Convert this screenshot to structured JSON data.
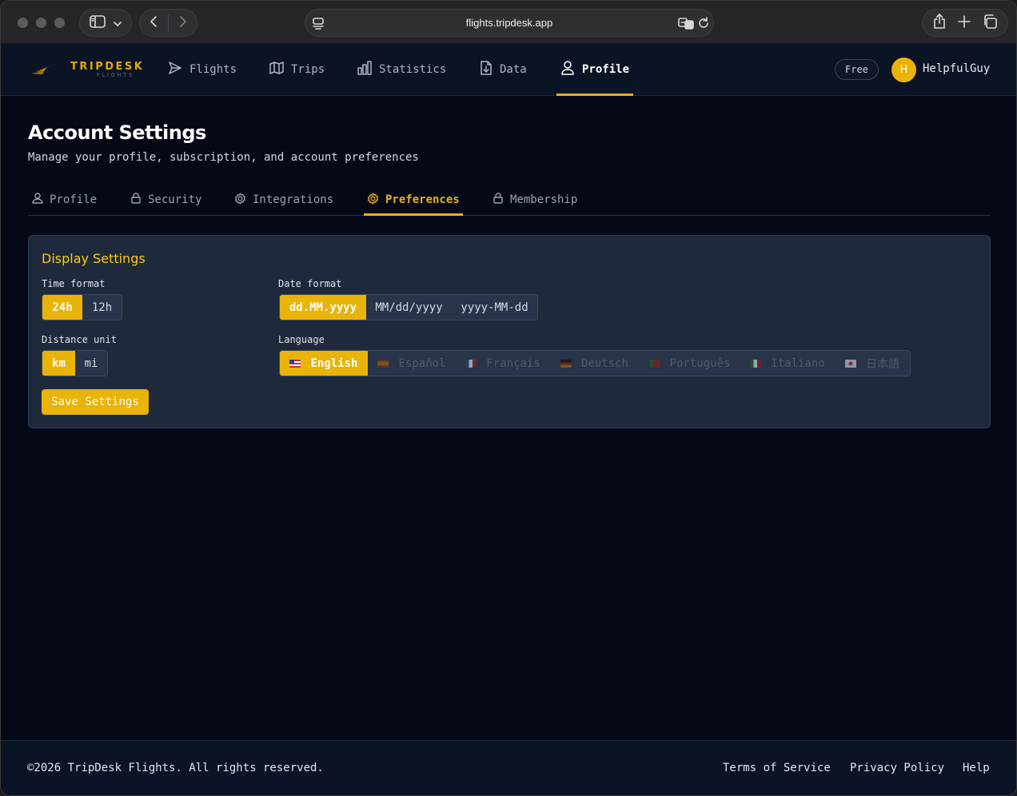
{
  "browser": {
    "url": "flights.tripdesk.app",
    "icons": [
      "sidebar-toggle-icon",
      "chevron-down-icon",
      "back-arrow-icon",
      "forward-arrow-icon",
      "page-menu-icon",
      "translate-icon",
      "reload-icon",
      "share-icon",
      "new-tab-icon",
      "tab-overview-icon"
    ]
  },
  "brand": {
    "name": "TRIPDESK",
    "sub": "FLIGHTS"
  },
  "nav": {
    "items": [
      {
        "label": "Flights",
        "icon": "send-icon"
      },
      {
        "label": "Trips",
        "icon": "map-icon"
      },
      {
        "label": "Statistics",
        "icon": "bar-chart-icon"
      },
      {
        "label": "Data",
        "icon": "file-download-icon"
      },
      {
        "label": "Profile",
        "icon": "user-icon",
        "active": true
      }
    ],
    "plan_badge": "Free",
    "avatar_initial": "H",
    "username": "HelpfulGuy"
  },
  "page": {
    "title": "Account Settings",
    "subtitle": "Manage your profile, subscription, and account preferences"
  },
  "tabs": [
    {
      "label": "Profile",
      "icon": "user-icon"
    },
    {
      "label": "Security",
      "icon": "lock-icon"
    },
    {
      "label": "Integrations",
      "icon": "gear-icon"
    },
    {
      "label": "Preferences",
      "icon": "gear-icon",
      "active": true
    },
    {
      "label": "Membership",
      "icon": "lock-icon"
    }
  ],
  "display_settings": {
    "title": "Display Settings",
    "time_format": {
      "label": "Time format",
      "options": [
        "24h",
        "12h"
      ],
      "selected": "24h"
    },
    "date_format": {
      "label": "Date format",
      "options": [
        "dd.MM.yyyy",
        "MM/dd/yyyy",
        "yyyy-MM-dd"
      ],
      "selected": "dd.MM.yyyy"
    },
    "distance_unit": {
      "label": "Distance unit",
      "options": [
        "km",
        "mi"
      ],
      "selected": "km"
    },
    "language": {
      "label": "Language",
      "options": [
        "English",
        "Español",
        "Français",
        "Deutsch",
        "Português",
        "Italiano",
        "日本語"
      ],
      "selected": "English"
    },
    "save_label": "Save Settings"
  },
  "colors": {
    "accent": "#eab308",
    "background": "#040817",
    "card": "#1e293b",
    "navbar": "#0b1424"
  },
  "footer": {
    "copyright": "©2026 TripDesk Flights. All rights reserved.",
    "links": [
      "Terms of Service",
      "Privacy Policy",
      "Help"
    ]
  }
}
